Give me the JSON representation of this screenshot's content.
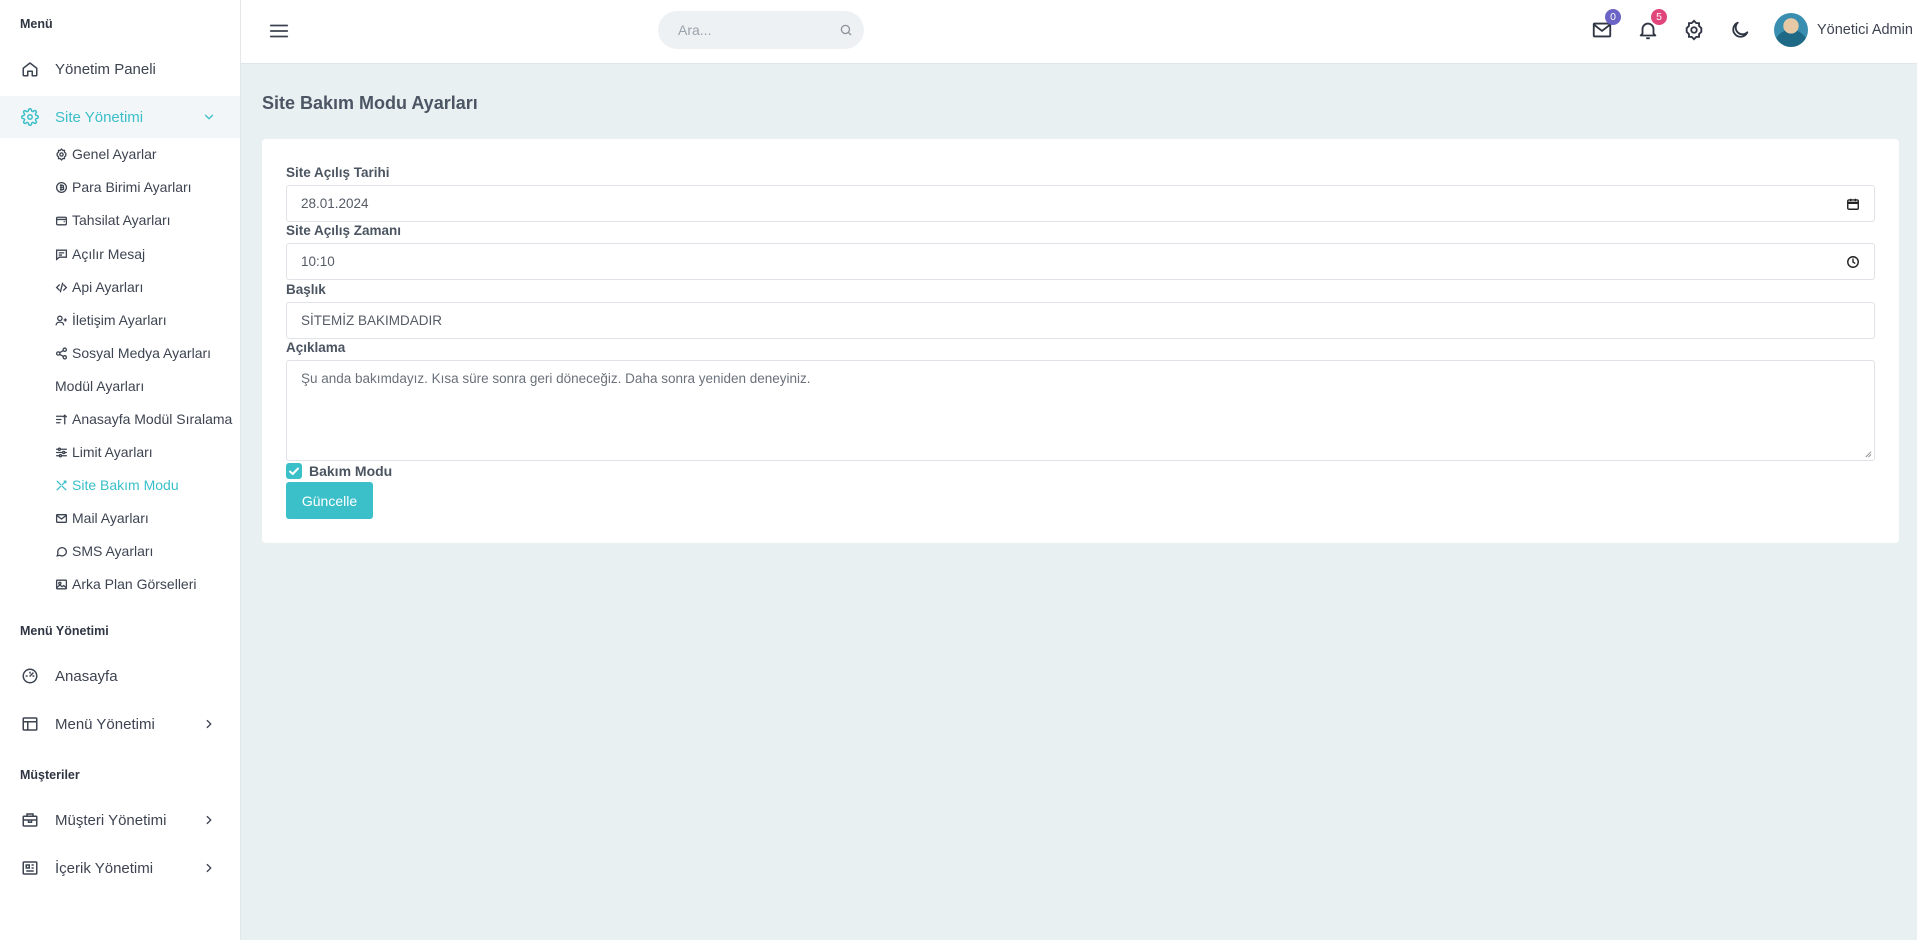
{
  "sidebar": {
    "sections": {
      "menu": "Menü",
      "menu_management": "Menü Yönetimi",
      "customers": "Müşteriler"
    },
    "items": {
      "dashboard": "Yönetim Paneli",
      "site_management": "Site Yönetimi",
      "home": "Anasayfa",
      "menu_management": "Menü Yönetimi",
      "customer_management": "Müşteri Yönetimi",
      "content_management": "İçerik Yönetimi"
    },
    "submenu": [
      {
        "label": "Genel Ayarlar",
        "icon": "settings-icon"
      },
      {
        "label": "Para Birimi Ayarları",
        "icon": "currency-icon"
      },
      {
        "label": "Tahsilat Ayarları",
        "icon": "wallet-icon"
      },
      {
        "label": "Açılır Mesaj",
        "icon": "message-icon"
      },
      {
        "label": "Api Ayarları",
        "icon": "code-icon"
      },
      {
        "label": "İletişim Ayarları",
        "icon": "contact-icon"
      },
      {
        "label": "Sosyal Medya Ayarları",
        "icon": "share-icon"
      },
      {
        "label": "Modül Ayarları",
        "icon": ""
      },
      {
        "label": "Anasayfa Modül Sıralama",
        "icon": "sort-icon"
      },
      {
        "label": "Limit Ayarları",
        "icon": "sliders-icon"
      },
      {
        "label": "Site Bakım Modu",
        "icon": "tools-icon"
      },
      {
        "label": "Mail Ayarları",
        "icon": "mail-icon"
      },
      {
        "label": "SMS Ayarları",
        "icon": "chat-icon"
      },
      {
        "label": "Arka Plan Görselleri",
        "icon": "image-icon"
      }
    ]
  },
  "topbar": {
    "search_placeholder": "Ara...",
    "mail_count": "0",
    "notification_count": "5",
    "user_name": "Yönetici Admin"
  },
  "page": {
    "title": "Site Bakım Modu Ayarları",
    "fields": {
      "open_date_label": "Site Açılış Tarihi",
      "open_date_value": "28.01.2024",
      "open_time_label": "Site Açılış Zamanı",
      "open_time_value": "10:10",
      "title_label": "Başlık",
      "title_value": "SİTEMİZ BAKIMDADIR",
      "description_label": "Açıklama",
      "description_value": "Şu anda bakımdayız. Kısa süre sonra geri döneceğiz. Daha sonra yeniden deneyiniz.",
      "maintenance_label": "Bakım Modu",
      "maintenance_checked": true
    },
    "submit_label": "Güncelle"
  },
  "colors": {
    "accent": "#3bbfc9",
    "mail_badge": "#6c63c7",
    "notification_badge": "#e0457b",
    "background": "#e9f0f2"
  }
}
